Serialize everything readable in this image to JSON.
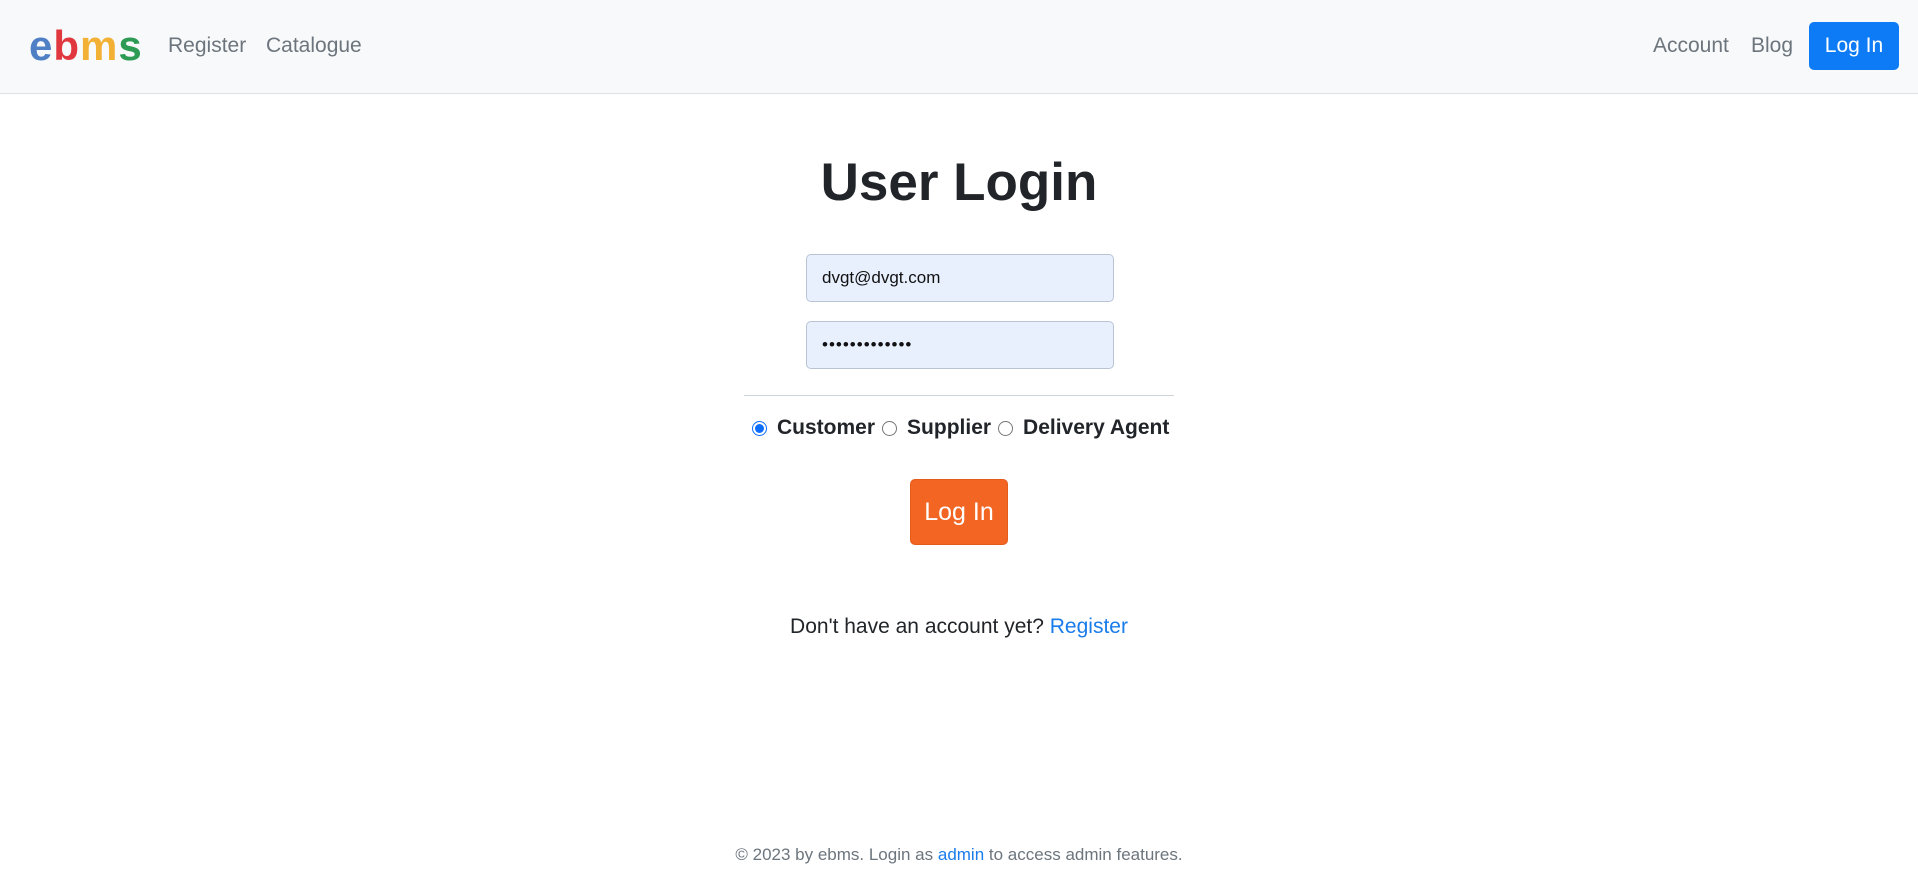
{
  "brand": {
    "letters": [
      "e",
      "b",
      "m",
      "s"
    ],
    "colors": [
      "#4f7fc4",
      "#e0383e",
      "#f2b134",
      "#2e9b54"
    ]
  },
  "nav": {
    "register": "Register",
    "catalogue": "Catalogue",
    "account": "Account",
    "blog": "Blog",
    "login": "Log In"
  },
  "login_form": {
    "title": "User Login",
    "email_value": "dvgt@dvgt.com",
    "password_value": "•••••••••••••",
    "roles": [
      "Customer",
      "Supplier",
      "Delivery Agent"
    ],
    "selected_role": "Customer",
    "submit_label": "Log In"
  },
  "signup": {
    "prompt": "Don't have an account yet?",
    "link": "Register"
  },
  "footer": {
    "prefix": "© 2023 by ebms. Login as",
    "admin_link": "admin",
    "suffix": "to access admin features."
  },
  "colors": {
    "primary": "#0d7bf5",
    "accent_orange": "#f26522",
    "link": "#1a7ceb",
    "autofill_bg": "#e8f0fe"
  }
}
